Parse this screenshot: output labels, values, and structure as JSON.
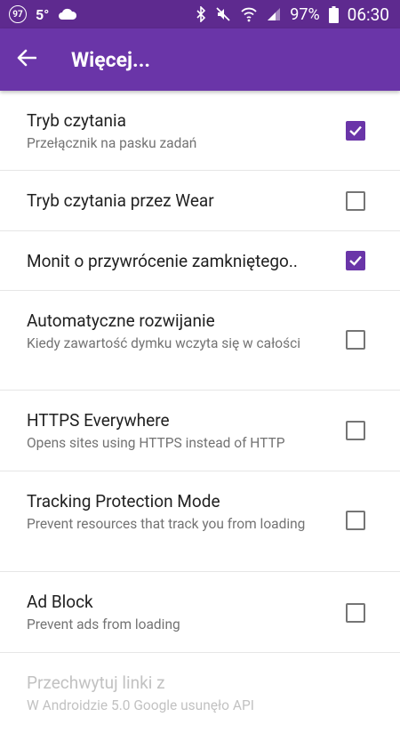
{
  "status_bar": {
    "notification_badge": "97",
    "temperature": "5°",
    "battery_percent": "97%",
    "time": "06:30"
  },
  "app_bar": {
    "title": "Więcej..."
  },
  "settings": [
    {
      "title": "Tryb czytania",
      "subtitle": "Przełącznik na pasku zadań",
      "checked": true
    },
    {
      "title": "Tryb czytania przez Wear",
      "subtitle": "",
      "checked": false
    },
    {
      "title": "Monit o przywrócenie zamkniętego..",
      "subtitle": "",
      "checked": true
    },
    {
      "title": "Automatyczne rozwijanie",
      "subtitle": "Kiedy zawartość dymku wczyta się w całości",
      "checked": false
    },
    {
      "title": "HTTPS Everywhere",
      "subtitle": "Opens sites using HTTPS instead of HTTP",
      "checked": false
    },
    {
      "title": "Tracking Protection Mode",
      "subtitle": "Prevent resources that track you from loading",
      "checked": false
    },
    {
      "title": "Ad Block",
      "subtitle": "Prevent ads from loading",
      "checked": false
    },
    {
      "title": "Przechwytuj linki z",
      "subtitle": "W Androidzie 5.0 Google usunęło API",
      "checked": false
    }
  ],
  "colors": {
    "status_bar": "#5e2a8f",
    "app_bar": "#6a35a8",
    "accent": "#6a35a8"
  }
}
